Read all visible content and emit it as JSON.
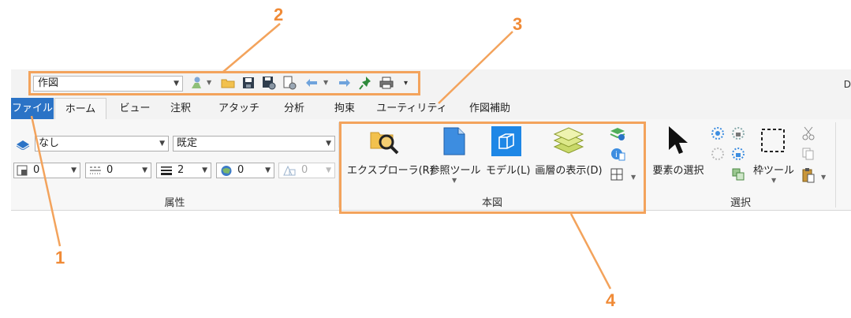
{
  "quick_access": {
    "file_combo": "作図"
  },
  "window": {
    "corner_text": "D"
  },
  "tabs": [
    {
      "label": "ファイル"
    },
    {
      "label": "ホーム"
    },
    {
      "label": "ビュー"
    },
    {
      "label": "注釈"
    },
    {
      "label": "アタッチ"
    },
    {
      "label": "分析"
    },
    {
      "label": "拘束"
    },
    {
      "label": "ユーティリティ"
    },
    {
      "label": "作図補助"
    }
  ],
  "attributes": {
    "level_value": "なし",
    "template_value": "既定",
    "color_value": "0",
    "style_value": "0",
    "weight_value": "2",
    "transparency_value": "0",
    "priority_value": "0",
    "group_label": "属性"
  },
  "primary": {
    "explorer_label": "エクスプローラ(R)",
    "references_label": "参照ツール",
    "models_label": "モデル(L)",
    "display_label": "画層の表示(D)",
    "group_label": "本図"
  },
  "selection": {
    "element_selection_label": "要素の選択",
    "fence_label": "枠ツール",
    "group_label": "選択"
  },
  "callouts": {
    "one": "1",
    "two": "2",
    "three": "3",
    "four": "4"
  },
  "colors": {
    "file_tab": "#2b73c6",
    "annotation": "#f3a35c",
    "callout_text": "#f08a36"
  }
}
